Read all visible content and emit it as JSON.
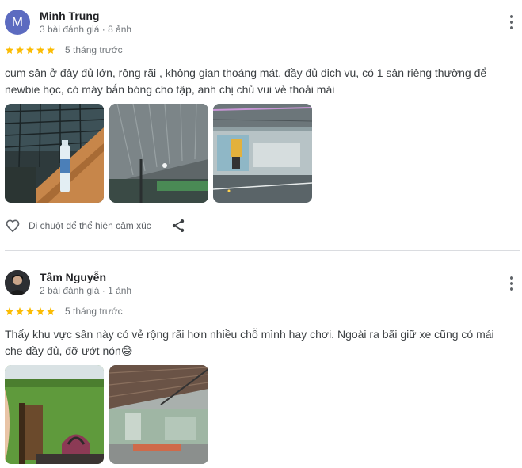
{
  "reviews": [
    {
      "author": "Minh Trung",
      "avatar_letter": "M",
      "avatar_color": "#5c6bc0",
      "meta": "3 bài đánh giá · 8 ảnh",
      "rating": 5,
      "time": "5 tháng trước",
      "text": "cụm sân ở đây đủ lớn, rộng rãi , không gian thoáng mát, đầy đủ dịch vụ, có 1 sân riêng thường để newbie học, có máy bắn bóng cho tập, anh chị chủ vui vẻ thoải mái",
      "photos": [
        "photo-water-bottle-bench",
        "photo-court-roof",
        "photo-court-mural"
      ],
      "react_label": "Di chuột để thể hiện cảm xúc"
    },
    {
      "author": "Tâm Nguyễn",
      "meta": "2 bài đánh giá · 1 ảnh",
      "rating": 5,
      "time": "5 tháng trước",
      "text": "Thấy khu vực sân này có vẻ rộng rãi hơn nhiều chỗ mình hay chơi. Ngoài ra bãi giữ xe cũng có mái che đầy đủ, đỡ ướt nón😅",
      "photos": [
        "photo-turf-chair",
        "photo-parking-roof"
      ]
    }
  ],
  "colors": {
    "star": "#fbbc04",
    "divider": "#dadce0"
  },
  "icons": [
    "more-vert-icon",
    "star-icon",
    "heart-outline-icon",
    "share-icon"
  ]
}
